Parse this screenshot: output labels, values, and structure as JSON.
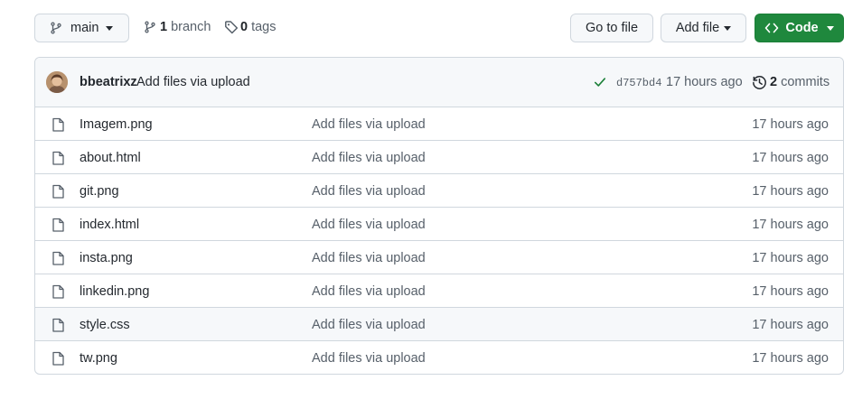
{
  "toolbar": {
    "branch_name": "main",
    "branches_count": "1",
    "branches_label": "branch",
    "tags_count": "0",
    "tags_label": "tags",
    "go_to_file": "Go to file",
    "add_file": "Add file",
    "code": "Code"
  },
  "latest_commit": {
    "author": "bbeatrixz",
    "message": "Add files via upload",
    "sha": "d757bd4",
    "time": "17 hours ago",
    "commits_count": "2",
    "commits_label": "commits"
  },
  "files": [
    {
      "name": "Imagem.png",
      "commit": "Add files via upload",
      "time": "17 hours ago"
    },
    {
      "name": "about.html",
      "commit": "Add files via upload",
      "time": "17 hours ago"
    },
    {
      "name": "git.png",
      "commit": "Add files via upload",
      "time": "17 hours ago"
    },
    {
      "name": "index.html",
      "commit": "Add files via upload",
      "time": "17 hours ago"
    },
    {
      "name": "insta.png",
      "commit": "Add files via upload",
      "time": "17 hours ago"
    },
    {
      "name": "linkedin.png",
      "commit": "Add files via upload",
      "time": "17 hours ago"
    },
    {
      "name": "style.css",
      "commit": "Add files via upload",
      "time": "17 hours ago"
    },
    {
      "name": "tw.png",
      "commit": "Add files via upload",
      "time": "17 hours ago"
    }
  ],
  "colors": {
    "primary_button": "#1f883d",
    "border": "#d0d7de",
    "muted_text": "#57606a",
    "success_check": "#1a7f37",
    "hovered_row_bg": "#f6f8fa"
  },
  "hovered_file": "style.css"
}
